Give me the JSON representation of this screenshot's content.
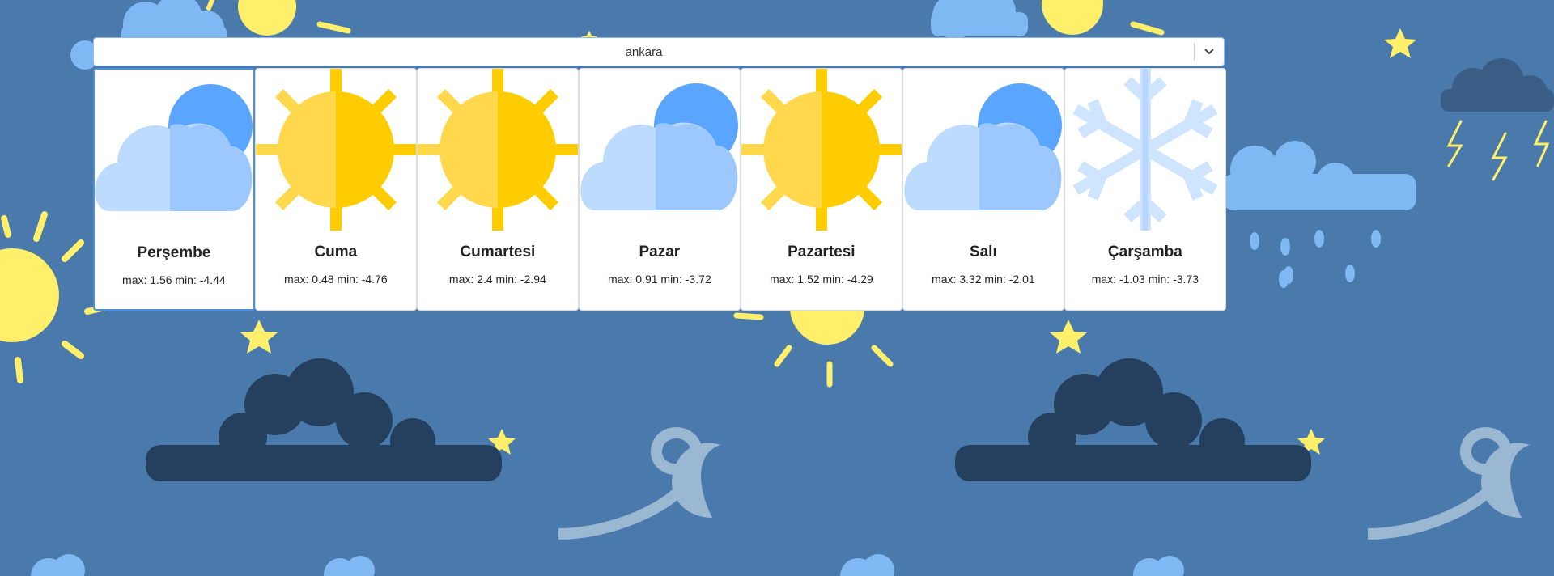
{
  "city_select": {
    "value": "ankara",
    "icon": "chevron-down-icon"
  },
  "days": [
    {
      "name": "Perşembe",
      "max_label": "max:",
      "max": "1.56",
      "min_label": "min:",
      "min": "-4.44",
      "icon": "cloud-sun-icon"
    },
    {
      "name": "Cuma",
      "max_label": "max:",
      "max": "0.48",
      "min_label": "min:",
      "min": "-4.76",
      "icon": "sun-icon"
    },
    {
      "name": "Cumartesi",
      "max_label": "max:",
      "max": "2.4",
      "min_label": "min:",
      "min": "-2.94",
      "icon": "sun-icon"
    },
    {
      "name": "Pazar",
      "max_label": "max:",
      "max": "0.91",
      "min_label": "min:",
      "min": "-3.72",
      "icon": "cloud-sun-icon"
    },
    {
      "name": "Pazartesi",
      "max_label": "max:",
      "max": "1.52",
      "min_label": "min:",
      "min": "-4.29",
      "icon": "sun-icon"
    },
    {
      "name": "Salı",
      "max_label": "max:",
      "max": "3.32",
      "min_label": "min:",
      "min": "-2.01",
      "icon": "cloud-sun-icon"
    },
    {
      "name": "Çarşamba",
      "max_label": "max:",
      "max": "-1.03",
      "min_label": "min:",
      "min": "-3.73",
      "icon": "snowflake-icon"
    }
  ],
  "colors": {
    "background": "#4a7aab",
    "sun_light": "#ffd84d",
    "sun_dark": "#ffcc00",
    "cloud_light": "#bcdbff",
    "cloud_dark": "#9cc8ff",
    "cloud_back": "#5aa5ff",
    "snow": "#cfe4ff",
    "select_border": "#86b7fe",
    "active_border": "#4a90e2"
  }
}
